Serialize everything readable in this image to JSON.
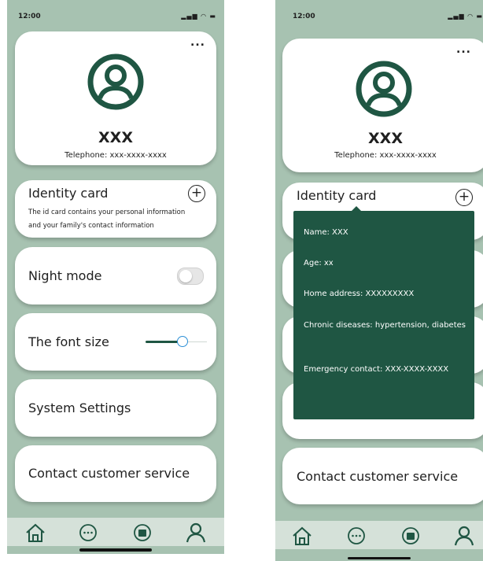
{
  "status_bar": {
    "time": "12:00",
    "icons": "▂▄▆ ◠ ▬"
  },
  "profile": {
    "more_label": "...",
    "name": "XXX",
    "telephone": "Telephone: xxx-xxxx-xxxx"
  },
  "identity_card": {
    "title": "Identity card",
    "add_icon": "plus-circle-icon",
    "description_line1": "The id card contains your personal information",
    "description_line2": "and your family's contact information"
  },
  "night_mode": {
    "label": "Night mode",
    "enabled": false
  },
  "font_size": {
    "label": "The font size",
    "level": 0.6
  },
  "system_settings": {
    "label": "System Settings"
  },
  "customer_service": {
    "label": "Contact customer service"
  },
  "identity_popover": {
    "name": "Name: XXX",
    "age": "Age: xx",
    "address": "Home address: XXXXXXXXX",
    "diseases": "Chronic diseases: hypertension, diabetes",
    "emergency": "Emergency contact: XXX-XXXX-XXXX"
  },
  "tab_bar": {
    "tabs": [
      {
        "icon": "home-icon"
      },
      {
        "icon": "chat-icon"
      },
      {
        "icon": "cart-icon"
      },
      {
        "icon": "user-icon"
      }
    ],
    "active_index": 3
  },
  "colors": {
    "primary": "#1f5643",
    "background": "#a7c2b1",
    "tab_bar": "#d5e1d9",
    "slider_thumb": "#2b8fd6"
  }
}
